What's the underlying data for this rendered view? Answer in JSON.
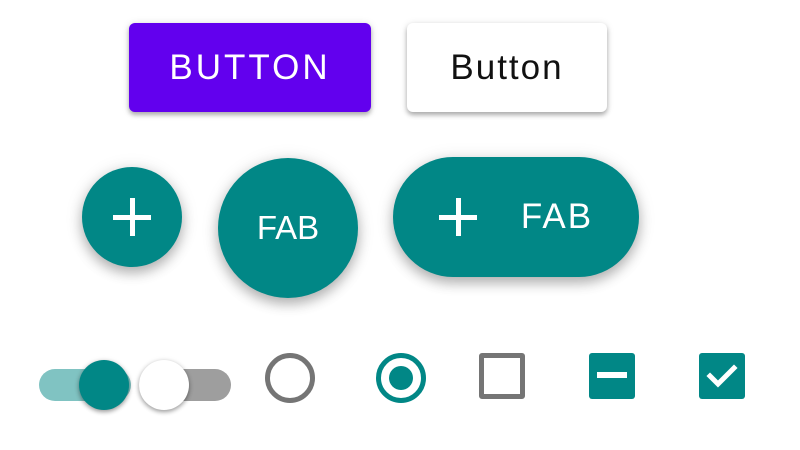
{
  "colors": {
    "primary": "#6200ee",
    "secondary": "#018786",
    "switch_track_on": "#80c3c2",
    "switch_track_off": "#9e9e9e",
    "switch_thumb_off": "#ffffff",
    "control_off": "#757575"
  },
  "buttons": {
    "contained_label": "BUTTON",
    "raised_white_label": "Button"
  },
  "fabs": {
    "small_icon": "plus-icon",
    "text_label": "FAB",
    "extended_icon": "plus-icon",
    "extended_label": "FAB"
  },
  "controls": {
    "switch_on": {
      "checked": true
    },
    "switch_off": {
      "checked": false
    },
    "radio_unchecked": {
      "checked": false
    },
    "radio_checked": {
      "checked": true
    },
    "checkbox_unchecked": {
      "state": "unchecked"
    },
    "checkbox_indeterminate": {
      "state": "indeterminate"
    },
    "checkbox_checked": {
      "state": "checked",
      "icon": "check-icon"
    }
  }
}
